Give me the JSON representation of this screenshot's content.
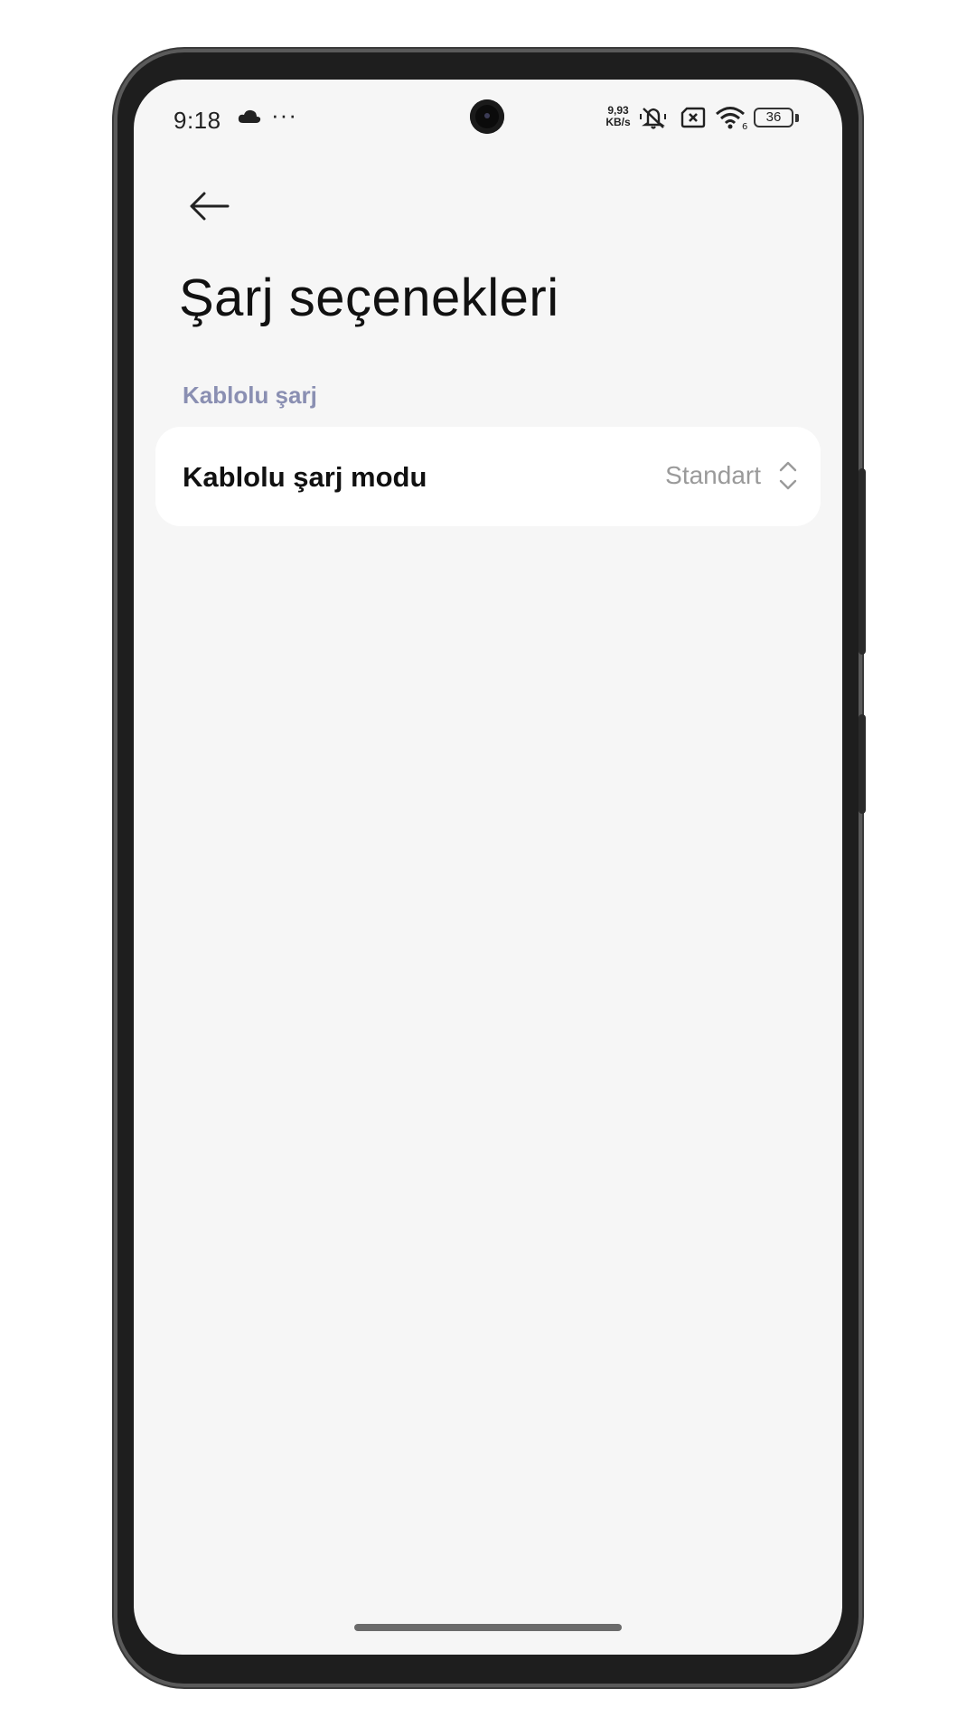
{
  "status_bar": {
    "time": "9:18",
    "dots": "···",
    "net_speed_value": "9,93",
    "net_speed_unit": "KB/s",
    "battery_level": "36",
    "icons": [
      "cloud-icon",
      "more-dots-icon",
      "mute-icon",
      "no-sim-icon",
      "wifi-icon",
      "battery-icon"
    ]
  },
  "header": {
    "back_icon": "arrow-left-icon",
    "title": "Şarj seçenekleri"
  },
  "section": {
    "label": "Kablolu şarj"
  },
  "setting": {
    "label": "Kablolu şarj modu",
    "value": "Standart",
    "icon": "updown-chevron-icon"
  },
  "colors": {
    "background": "#f6f6f6",
    "card": "#ffffff",
    "section_accent": "#8a8fb2",
    "value_text": "#9a9a9a"
  }
}
